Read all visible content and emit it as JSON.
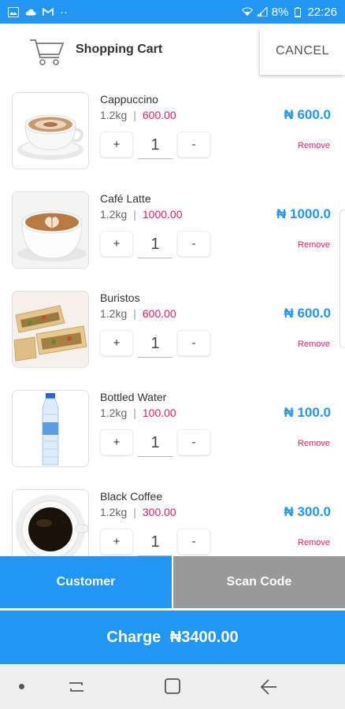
{
  "status_bar": {
    "battery": "8%",
    "time": "22:26",
    "dots": "··"
  },
  "header": {
    "title": "Shopping Cart",
    "cancel_label": "CANCEL"
  },
  "currency_symbol": "₦",
  "items": [
    {
      "name": "Cappuccino",
      "weight": "1.2kg",
      "separator": "|",
      "unit_price": "600.00",
      "plus": "+",
      "qty": "1",
      "minus": "-",
      "total": "₦ 600.0",
      "remove": "Remove",
      "image": "cappuccino"
    },
    {
      "name": "Café Latte",
      "weight": "1.2kg",
      "separator": "|",
      "unit_price": "1000.00",
      "plus": "+",
      "qty": "1",
      "minus": "-",
      "total": "₦ 1000.0",
      "remove": "Remove",
      "image": "cafe-latte"
    },
    {
      "name": "Buristos",
      "weight": "1.2kg",
      "separator": "|",
      "unit_price": "600.00",
      "plus": "+",
      "qty": "1",
      "minus": "-",
      "total": "₦ 600.0",
      "remove": "Remove",
      "image": "buristos"
    },
    {
      "name": "Bottled Water",
      "weight": "1.2kg",
      "separator": "|",
      "unit_price": "100.00",
      "plus": "+",
      "qty": "1",
      "minus": "-",
      "total": "₦ 100.0",
      "remove": "Remove",
      "image": "bottled-water"
    },
    {
      "name": "Black Coffee",
      "weight": "1.2kg",
      "separator": "|",
      "unit_price": "300.00",
      "plus": "+",
      "qty": "1",
      "minus": "-",
      "total": "₦ 300.0",
      "remove": "Remove",
      "image": "black-coffee"
    }
  ],
  "actions": {
    "customer_label": "Customer",
    "scan_label": "Scan Code",
    "charge_label": "Charge",
    "charge_amount": "₦3400.00"
  },
  "colors": {
    "primary": "#2196f3",
    "accent_pink": "#e91e63",
    "scan_gray": "#999999",
    "nav_bg": "#efefef"
  },
  "icons": {
    "status_left": [
      "gallery-icon",
      "cloud-icon",
      "gmail-icon"
    ],
    "status_right": [
      "wifi-icon",
      "signal-icon"
    ],
    "header": "shopping-cart-icon",
    "nav": [
      "nav-dot-icon",
      "recent-apps-icon",
      "home-icon",
      "back-icon"
    ]
  }
}
